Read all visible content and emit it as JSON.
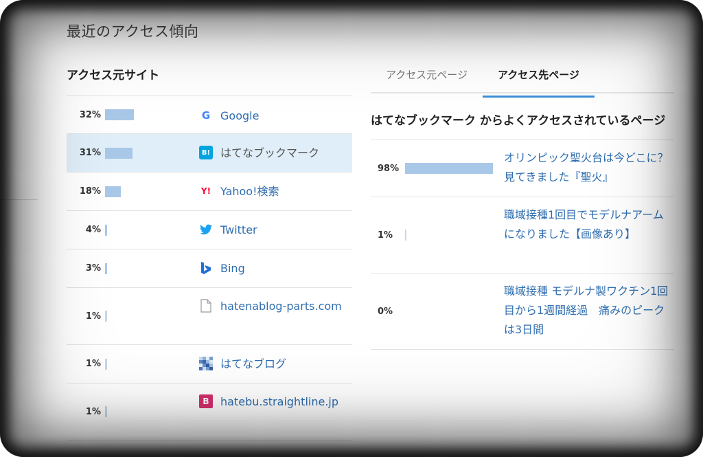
{
  "page_title": "最近のアクセス傾向",
  "referrers": {
    "title": "アクセス元サイト",
    "rows": [
      {
        "percent": "32%",
        "value": 32,
        "icon": "google-icon",
        "label": "Google"
      },
      {
        "percent": "31%",
        "value": 31,
        "icon": "hatena-bookmark-icon",
        "label": "はてなブックマーク"
      },
      {
        "percent": "18%",
        "value": 18,
        "icon": "yahoo-icon",
        "label": "Yahoo!検索"
      },
      {
        "percent": "4%",
        "value": 4,
        "icon": "twitter-icon",
        "label": "Twitter"
      },
      {
        "percent": "3%",
        "value": 3,
        "icon": "bing-icon",
        "label": "Bing"
      },
      {
        "percent": "1%",
        "value": 1,
        "icon": "document-icon",
        "label": "hatenablog-parts.com"
      },
      {
        "percent": "1%",
        "value": 1,
        "icon": "hatena-blog-icon",
        "label": "はてなブログ"
      },
      {
        "percent": "1%",
        "value": 1,
        "icon": "hatebu-icon",
        "label": "hatebu.straightline.jp"
      }
    ],
    "icon_glyphs": {
      "google": "G",
      "hatena_bookmark": "B!",
      "yahoo": "Y!",
      "hatebu": "B"
    }
  },
  "tabs": [
    {
      "label": "アクセス元ページ",
      "active": false
    },
    {
      "label": "アクセス先ページ",
      "active": true
    }
  ],
  "pages": {
    "title": "はてなブックマーク からよくアクセスされているページ",
    "rows": [
      {
        "percent": "98%",
        "value": 98,
        "label": "オリンピック聖火台は今どこに？ 見てきました『聖火』"
      },
      {
        "percent": "1%",
        "value": 1,
        "label": "職域接種1回目でモデルナアームになりました【画像あり】"
      },
      {
        "percent": "0%",
        "value": 0,
        "label": "職域接種 モデルナ製ワクチン1回目から1週間経過　痛みのピークは3日間"
      }
    ]
  },
  "colors": {
    "bar": "#a9c8e8",
    "link": "#2f6eb0",
    "highlight": "#dfeef9",
    "tab_accent": "#3b8ed8"
  }
}
